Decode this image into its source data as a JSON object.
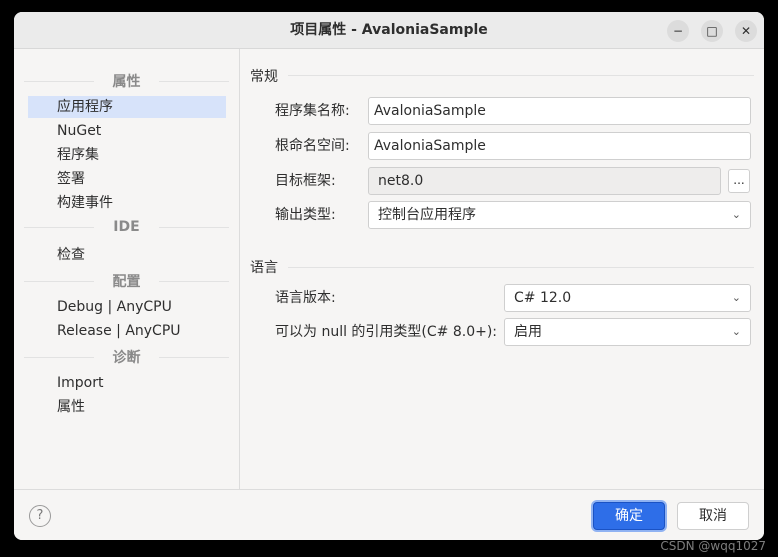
{
  "window": {
    "title": "项目属性 - AvaloniaSample",
    "controls": {
      "minimize": "−",
      "maximize": "□",
      "close": "✕"
    }
  },
  "sidebar": {
    "headers": [
      "属性",
      "IDE",
      "配置",
      "诊断"
    ],
    "items": [
      {
        "label": "应用程序",
        "selected": true
      },
      {
        "label": "NuGet"
      },
      {
        "label": "程序集"
      },
      {
        "label": "签署"
      },
      {
        "label": "构建事件"
      },
      {
        "label": "检查"
      },
      {
        "label": "Debug | AnyCPU"
      },
      {
        "label": "Release | AnyCPU"
      },
      {
        "label": "Import"
      },
      {
        "label": "属性"
      }
    ]
  },
  "general": {
    "title": "常规",
    "assembly_name_label": "程序集名称:",
    "assembly_name": "AvaloniaSample",
    "root_namespace_label": "根命名空间:",
    "root_namespace": "AvaloniaSample",
    "target_framework_label": "目标框架:",
    "target_framework": "net8.0",
    "browse_button": "...",
    "output_type_label": "输出类型:",
    "output_type": "控制台应用程序"
  },
  "language": {
    "title": "语言",
    "version_label": "语言版本:",
    "version": "C# 12.0",
    "nullable_label": "可以为 null 的引用类型(C# 8.0+):",
    "nullable": "启用"
  },
  "footer": {
    "help": "?",
    "ok": "确定",
    "cancel": "取消"
  },
  "watermark": "CSDN @wqq1027",
  "colors": {
    "accent": "#2e6ee8",
    "selection": "#d7e3fa"
  }
}
